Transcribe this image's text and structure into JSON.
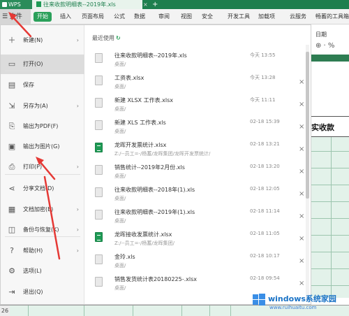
{
  "titlebar": {
    "app_label": "WPS",
    "tab_title": "往来收款明细表--2019年.xls",
    "close": "×",
    "plus": "+"
  },
  "menubar": {
    "file_label": "☰ 文件",
    "start_label": "开始",
    "items": [
      "插入",
      "页面布局",
      "公式",
      "数据",
      "审阅",
      "视图",
      "安全",
      "开发工具",
      "加载项",
      "云服务",
      "畅蓄的工具箱"
    ]
  },
  "right_sheet": {
    "format_label": "日期",
    "format_symbols": "⊕ · %",
    "header_text": "实收款"
  },
  "bottom_row_number": "26",
  "sidebar": {
    "items": [
      {
        "label": "新建(N)",
        "icon": "new-icon",
        "glyph": "＋",
        "arrow": true
      },
      {
        "label": "打开(O)",
        "icon": "folder-icon",
        "glyph": "▭",
        "arrow": false,
        "active": true
      },
      {
        "label": "保存",
        "icon": "save-icon",
        "glyph": "▤",
        "arrow": false
      },
      {
        "label": "另存为(A)",
        "icon": "save-as-icon",
        "glyph": "⇲",
        "arrow": true
      },
      {
        "label": "输出为PDF(F)",
        "icon": "pdf-icon",
        "glyph": "⎘",
        "arrow": false
      },
      {
        "label": "输出为图片(G)",
        "icon": "image-icon",
        "glyph": "▣",
        "arrow": false
      },
      {
        "label": "打印(P)",
        "icon": "print-icon",
        "glyph": "⎙",
        "arrow": true
      },
      {
        "label": "分享文档(D)",
        "icon": "share-icon",
        "glyph": "⋖",
        "arrow": false
      },
      {
        "label": "文档加密(E)",
        "icon": "encrypt-icon",
        "glyph": "▦",
        "arrow": true
      },
      {
        "label": "备份与恢复(K)",
        "icon": "backup-icon",
        "glyph": "◫",
        "arrow": true
      },
      {
        "label": "帮助(H)",
        "icon": "help-icon",
        "glyph": "?",
        "arrow": true
      },
      {
        "label": "选项(L)",
        "icon": "gear-icon",
        "glyph": "⚙",
        "arrow": false
      },
      {
        "label": "退出(Q)",
        "icon": "exit-icon",
        "glyph": "⇥",
        "arrow": false
      }
    ]
  },
  "recent": {
    "title": "最近使用",
    "refresh": "↻",
    "files": [
      {
        "name": "往来收款明细表--2019年.xls",
        "path": "桌面/",
        "date": "今天 13:55",
        "green": false,
        "close": false
      },
      {
        "name": "工资表.xlsx",
        "path": "桌面/",
        "date": "今天 13:28",
        "green": false,
        "close": true
      },
      {
        "name": "新建 XLSX 工作表.xlsx",
        "path": "桌面/",
        "date": "今天 11:11",
        "green": false,
        "close": true
      },
      {
        "name": "新建 XLS 工作表.xls",
        "path": "桌面/",
        "date": "02-18 15:39",
        "green": false,
        "close": true
      },
      {
        "name": "龙晖开发票统计.xlsx",
        "path": "Z:/--员工=-/杨蓄/龙晖集团/龙晖开发票统计/",
        "date": "02-18 13:21",
        "green": true,
        "close": true
      },
      {
        "name": "销售统计--2019年2月份.xls",
        "path": "桌面/",
        "date": "02-18 13:20",
        "green": false,
        "close": true
      },
      {
        "name": "往来收款明细表--2018年(1).xls",
        "path": "桌面/",
        "date": "02-18 12:05",
        "green": false,
        "close": true
      },
      {
        "name": "往来收款明细表--2019年(1).xls",
        "path": "桌面/",
        "date": "02-18 11:14",
        "green": false,
        "close": true
      },
      {
        "name": "龙晖接收发票统计.xlsx",
        "path": "Z:/--员工=-/杨蓄/龙晖集团/",
        "date": "02-18 11:05",
        "green": true,
        "close": true
      },
      {
        "name": "金玲.xls",
        "path": "桌面/",
        "date": "02-18 10:17",
        "green": false,
        "close": true
      },
      {
        "name": "销售发货统计表20180225-.xlsx",
        "path": "桌面/",
        "date": "02-18 09:54",
        "green": false,
        "close": true
      }
    ]
  },
  "watermark": {
    "title": "windows",
    "title_suffix": "系统家园",
    "url": "www.ruihuaitu.com"
  },
  "colors": {
    "accent": "#2aa05a",
    "titlebar": "#1e7f4e",
    "annotation": "#e53935",
    "sheet": "#e3f2ea"
  }
}
